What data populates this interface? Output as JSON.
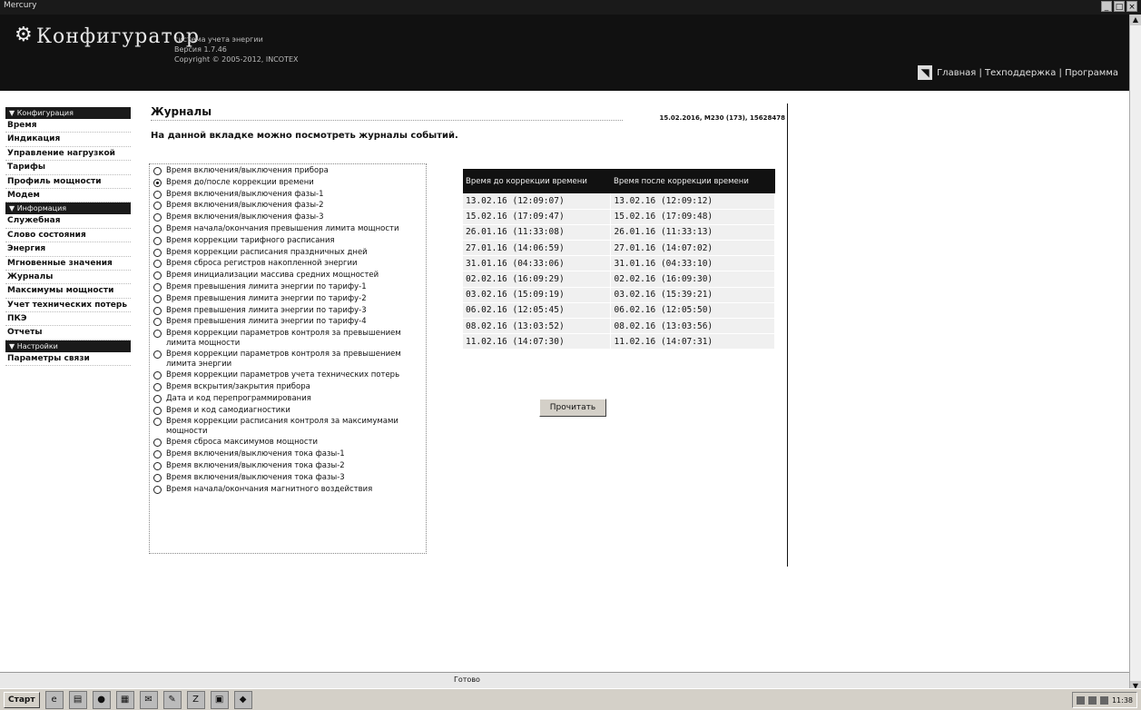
{
  "window": {
    "title": "Mercury"
  },
  "header": {
    "app_name": "Конфигуратор",
    "meta_line1": "система учета энергии",
    "meta_line2": "Версия 1.7.46",
    "copyright": "Copyright © 2005-2012, INCOTEX",
    "links": "Главная | Техподдержка | Программа"
  },
  "sidebar": {
    "sections": [
      {
        "title": "▼ Конфигурация",
        "items": [
          "Время",
          "Индикация",
          "Управление нагрузкой",
          "Тарифы",
          "Профиль мощности",
          "Модем"
        ]
      },
      {
        "title": "▼ Информация",
        "items": [
          "Служебная",
          "Слово состояния",
          "Энергия",
          "Мгновенные значения",
          "Журналы",
          "Максимумы мощности",
          "Учет технических потерь",
          "ПКЭ",
          "Отчеты"
        ]
      },
      {
        "title": "▼ Настройки",
        "items": [
          "Параметры связи"
        ]
      }
    ]
  },
  "main": {
    "title": "Журналы",
    "device_info": "15.02.2016, M230 (173), 15628478",
    "description": "На данной вкладке можно посмотреть журналы событий.",
    "read_button": "Прочитать"
  },
  "journals": [
    {
      "label": "Время включения/выключения прибора",
      "selected": false
    },
    {
      "label": "Время до/после коррекции времени",
      "selected": true
    },
    {
      "label": "Время включения/выключения фазы-1",
      "selected": false
    },
    {
      "label": "Время включения/выключения фазы-2",
      "selected": false
    },
    {
      "label": "Время включения/выключения фазы-3",
      "selected": false
    },
    {
      "label": "Время начала/окончания превышения лимита мощности",
      "selected": false
    },
    {
      "label": "Время коррекции тарифного расписания",
      "selected": false
    },
    {
      "label": "Время коррекции расписания праздничных дней",
      "selected": false
    },
    {
      "label": "Время сброса регистров накопленной энергии",
      "selected": false
    },
    {
      "label": "Время инициализации массива средних мощностей",
      "selected": false
    },
    {
      "label": "Время превышения лимита энергии по тарифу-1",
      "selected": false
    },
    {
      "label": "Время превышения лимита энергии по тарифу-2",
      "selected": false
    },
    {
      "label": "Время превышения лимита энергии по тарифу-3",
      "selected": false
    },
    {
      "label": "Время превышения лимита энергии по тарифу-4",
      "selected": false
    },
    {
      "label": "Время коррекции параметров контроля за превышением лимита мощности",
      "selected": false
    },
    {
      "label": "Время коррекции параметров контроля за превышением лимита энергии",
      "selected": false
    },
    {
      "label": "Время коррекции параметров учета технических потерь",
      "selected": false
    },
    {
      "label": "Время вскрытия/закрытия прибора",
      "selected": false
    },
    {
      "label": "Дата и код перепрограммирования",
      "selected": false
    },
    {
      "label": "Время и код самодиагностики",
      "selected": false
    },
    {
      "label": "Время коррекции расписания контроля за максимумами мощности",
      "selected": false
    },
    {
      "label": "Время сброса максимумов мощности",
      "selected": false
    },
    {
      "label": "Время включения/выключения тока фазы-1",
      "selected": false
    },
    {
      "label": "Время включения/выключения тока фазы-2",
      "selected": false
    },
    {
      "label": "Время включения/выключения тока фазы-3",
      "selected": false
    },
    {
      "label": "Время начала/окончания магнитного воздействия",
      "selected": false
    }
  ],
  "table": {
    "headers": [
      "Время до коррекции времени",
      "Время после коррекции времени"
    ],
    "rows": [
      [
        "13.02.16 (12:09:07)",
        "13.02.16 (12:09:12)"
      ],
      [
        "15.02.16 (17:09:47)",
        "15.02.16 (17:09:48)"
      ],
      [
        "26.01.16 (11:33:08)",
        "26.01.16 (11:33:13)"
      ],
      [
        "27.01.16 (14:06:59)",
        "27.01.16 (14:07:02)"
      ],
      [
        "31.01.16 (04:33:06)",
        "31.01.16 (04:33:10)"
      ],
      [
        "02.02.16 (16:09:29)",
        "02.02.16 (16:09:30)"
      ],
      [
        "03.02.16 (15:09:19)",
        "03.02.16 (15:39:21)"
      ],
      [
        "06.02.16 (12:05:45)",
        "06.02.16 (12:05:50)"
      ],
      [
        "08.02.16 (13:03:52)",
        "08.02.16 (13:03:56)"
      ],
      [
        "11.02.16 (14:07:30)",
        "11.02.16 (14:07:31)"
      ]
    ]
  },
  "statusbar": {
    "text": "Готово"
  },
  "taskbar": {
    "start_label": "Старт",
    "icons": [
      "ie-icon",
      "folder-icon",
      "media-icon",
      "app-icon",
      "mail-icon",
      "paint-icon",
      "archiver-icon",
      "save-icon",
      "mercury-icon"
    ],
    "clock": "11:38"
  }
}
